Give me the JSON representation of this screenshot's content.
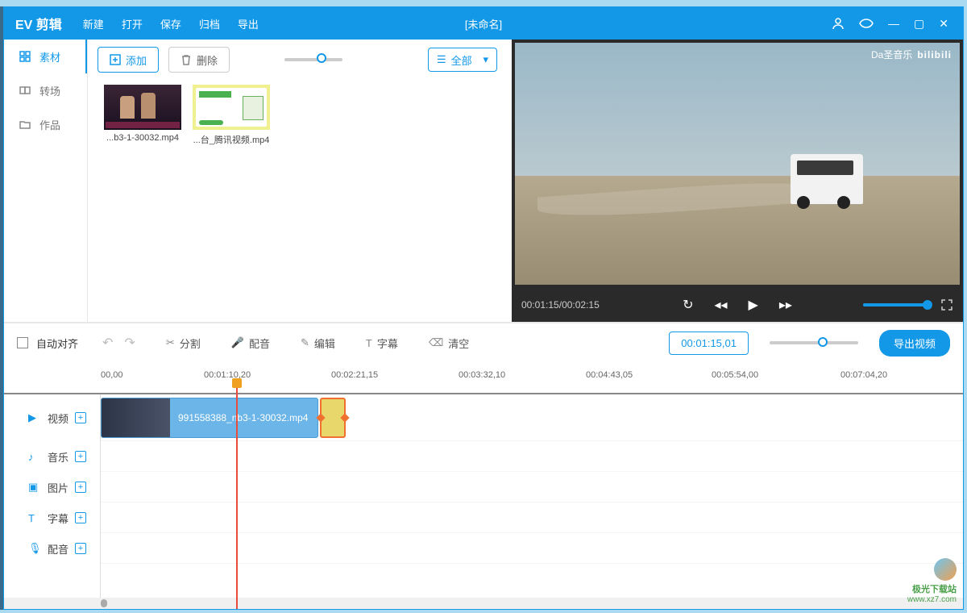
{
  "titlebar": {
    "logo_text": "EV 剪辑",
    "menu": {
      "new": "新建",
      "open": "打开",
      "save": "保存",
      "archive": "归档",
      "export": "导出"
    },
    "project_title": "[未命名]"
  },
  "sidebar": {
    "tabs": [
      {
        "label": "素材"
      },
      {
        "label": "转场"
      },
      {
        "label": "作品"
      }
    ]
  },
  "media_toolbar": {
    "add_label": "添加",
    "delete_label": "删除",
    "filter_label": "全部"
  },
  "media_clips": [
    {
      "name": "...b3-1-30032.mp4"
    },
    {
      "name": "...台_腾讯视频.mp4"
    }
  ],
  "preview": {
    "watermark_text": "Da圣音乐",
    "watermark_brand": "bilibili",
    "time_current": "00:01:15",
    "time_total": "00:02:15"
  },
  "toolbar": {
    "auto_align": "自动对齐",
    "split": "分割",
    "voiceover": "配音",
    "edit": "编辑",
    "subtitle": "字幕",
    "clear": "清空",
    "time_indicator": "00:01:15,01",
    "export_video": "导出视频"
  },
  "timeline": {
    "ruler": [
      "00,00",
      "00:01:10,20",
      "00:02:21,15",
      "00:03:32,10",
      "00:04:43,05",
      "00:05:54,00",
      "00:07:04,20"
    ],
    "tracks": [
      {
        "label": "视频"
      },
      {
        "label": "音乐"
      },
      {
        "label": "图片"
      },
      {
        "label": "字幕"
      },
      {
        "label": "配音"
      }
    ],
    "video_clip_name": "991558388_nb3-1-30032.mp4"
  },
  "site_watermark": {
    "line1": "极光下载站",
    "line2": "www.xz7.com"
  }
}
